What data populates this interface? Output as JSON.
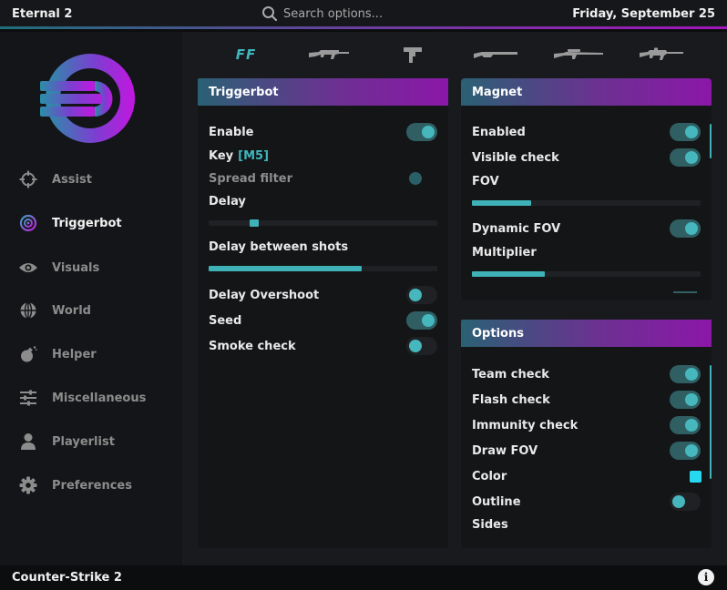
{
  "app": {
    "title": "Eternal 2",
    "date": "Friday, September 25"
  },
  "search": {
    "placeholder": "Search options...",
    "value": ""
  },
  "sidebar": {
    "items": [
      {
        "label": "Assist",
        "icon": "crosshair-icon",
        "active": false
      },
      {
        "label": "Triggerbot",
        "icon": "target-icon",
        "active": true
      },
      {
        "label": "Visuals",
        "icon": "eye-icon",
        "active": false
      },
      {
        "label": "World",
        "icon": "globe-icon",
        "active": false
      },
      {
        "label": "Helper",
        "icon": "grenade-icon",
        "active": false
      },
      {
        "label": "Miscellaneous",
        "icon": "sliders-icon",
        "active": false
      },
      {
        "label": "Playerlist",
        "icon": "user-icon",
        "active": false
      },
      {
        "label": "Preferences",
        "icon": "gear-icon",
        "active": false
      }
    ]
  },
  "weapon_tabs": [
    {
      "label": "FF",
      "icon": "ff-icon",
      "active": true
    },
    {
      "label": "",
      "icon": "rifle-icon",
      "active": false
    },
    {
      "label": "",
      "icon": "pistol-icon",
      "active": false
    },
    {
      "label": "",
      "icon": "shotgun-icon",
      "active": false
    },
    {
      "label": "",
      "icon": "sniper-icon",
      "active": false
    },
    {
      "label": "",
      "icon": "lmg-icon",
      "active": false
    }
  ],
  "triggerbot": {
    "title": "Triggerbot",
    "enable": {
      "label": "Enable",
      "on": true
    },
    "key": {
      "label": "Key",
      "value": "[M5]"
    },
    "spread_filter": {
      "label": "Spread filter",
      "on": false
    },
    "delay": {
      "label": "Delay",
      "fraction": 0.2
    },
    "delay_between_shots": {
      "label": "Delay between shots",
      "fraction": 0.67
    },
    "delay_overshoot": {
      "label": "Delay Overshoot",
      "on": false
    },
    "seed": {
      "label": "Seed",
      "on": true
    },
    "smoke_check": {
      "label": "Smoke check",
      "on": false
    }
  },
  "magnet": {
    "title": "Magnet",
    "enabled": {
      "label": "Enabled",
      "on": true
    },
    "visible_check": {
      "label": "Visible check",
      "on": true
    },
    "fov": {
      "label": "FOV",
      "fraction": 0.26
    },
    "dynamic_fov": {
      "label": "Dynamic FOV",
      "on": true
    },
    "multiplier": {
      "label": "Multiplier",
      "fraction": 0.32
    }
  },
  "options": {
    "title": "Options",
    "team_check": {
      "label": "Team check",
      "on": true
    },
    "flash_check": {
      "label": "Flash check",
      "on": true
    },
    "immunity_check": {
      "label": "Immunity check",
      "on": true
    },
    "draw_fov": {
      "label": "Draw FOV",
      "on": true
    },
    "color": {
      "label": "Color",
      "value": "#27d9f0"
    },
    "outline": {
      "label": "Outline",
      "on": false
    },
    "sides": {
      "label": "Sides"
    }
  },
  "footer": {
    "title": "Counter-Strike 2",
    "info_icon": "info-icon",
    "info_glyph": "i"
  },
  "colors": {
    "accent": "#3fb2b8",
    "gradient_start": "#2a6174",
    "gradient_end": "#8b17a8"
  }
}
